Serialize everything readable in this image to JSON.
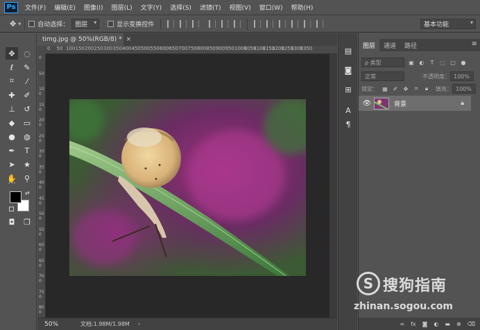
{
  "app": {
    "logo": "Ps"
  },
  "menu": [
    "文件(F)",
    "编辑(E)",
    "图像(I)",
    "图层(L)",
    "文字(Y)",
    "选择(S)",
    "滤镜(T)",
    "视图(V)",
    "窗口(W)",
    "帮助(H)"
  ],
  "options": {
    "auto_select_label": "自动选择：",
    "auto_select_value": "图层",
    "show_transform_label": "显示变换控件",
    "workspace": "基本功能"
  },
  "document": {
    "tab_title": "timg.jpg @ 50%(RGB/8) *",
    "close_glyph": "×",
    "zoom": "50%",
    "doc_size": "文档:1.98M/1.98M",
    "status_arrow": "›"
  },
  "ruler": {
    "h_labels": [
      "0",
      "50",
      "100",
      "150",
      "200",
      "250",
      "300",
      "350",
      "400",
      "450",
      "500",
      "550",
      "600",
      "650",
      "700",
      "750",
      "800",
      "850",
      "900",
      "950",
      "1000",
      "1050",
      "1100",
      "1150",
      "1200",
      "1250",
      "1300",
      "1350"
    ],
    "v_labels": [
      "0",
      "50",
      "100",
      "150",
      "200",
      "250",
      "300",
      "350",
      "400",
      "450",
      "500",
      "550",
      "600",
      "650",
      "700",
      "750",
      "800"
    ]
  },
  "layers_panel": {
    "tabs": [
      "图层",
      "通道",
      "路径"
    ],
    "menu_glyph": "≡",
    "filter_placeholder": "ρ 类型",
    "blend_mode": "正常",
    "opacity_label": "不透明度：",
    "opacity_value": "100%",
    "lock_label": "锁定：",
    "fill_label": "填充：",
    "fill_value": "100%",
    "layer_name": "背景"
  },
  "tool_icons": [
    "move-icon",
    "marquee-icon",
    "lasso-icon",
    "quick-select-icon",
    "crop-icon",
    "eyedropper-icon",
    "healing-icon",
    "brush-icon",
    "stamp-icon",
    "history-brush-icon",
    "eraser-icon",
    "gradient-icon",
    "blur-icon",
    "dodge-icon",
    "pen-icon",
    "type-icon",
    "path-select-icon",
    "shape-icon",
    "hand-icon",
    "zoom-icon"
  ],
  "colors": {
    "foreground": "#000000",
    "background": "#ffffff"
  },
  "watermark": {
    "logo_letter": "S",
    "brand": "搜狗指南",
    "url": "zhinan.sogou.com"
  }
}
